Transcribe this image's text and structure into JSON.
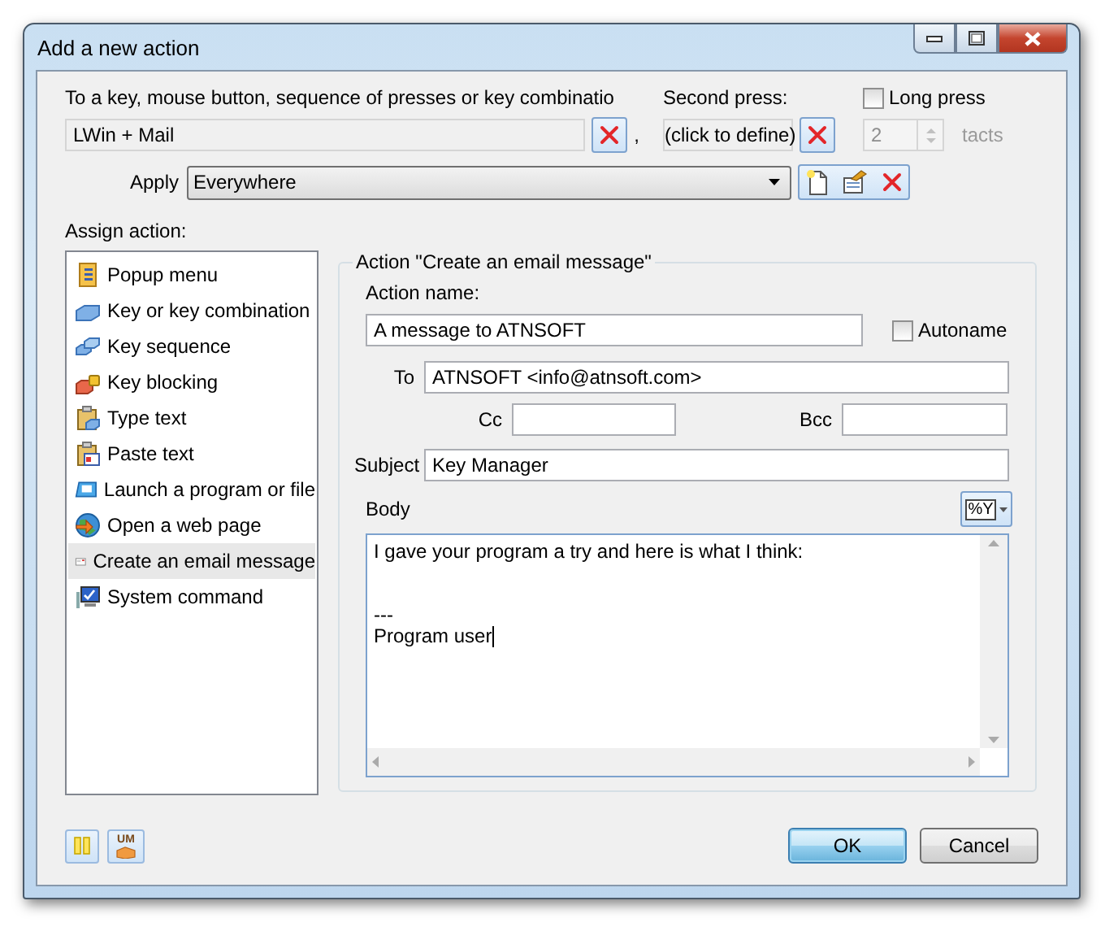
{
  "window": {
    "title": "Add a new action"
  },
  "trigger": {
    "label": "To a key, mouse button, sequence of presses or key combinatio",
    "value": "LWin + Mail",
    "separator": ","
  },
  "second_press": {
    "label": "Second press:",
    "value": "(click to define)"
  },
  "long_press": {
    "label": "Long press",
    "checked": false,
    "count": "2",
    "unit": "tacts",
    "disabled": true
  },
  "apply": {
    "label": "Apply",
    "value": "Everywhere"
  },
  "assign_action": {
    "label": "Assign action:",
    "items": [
      {
        "label": "Popup menu",
        "selected": false
      },
      {
        "label": "Key or key combination",
        "selected": false
      },
      {
        "label": "Key sequence",
        "selected": false
      },
      {
        "label": "Key blocking",
        "selected": false
      },
      {
        "label": "Type text",
        "selected": false
      },
      {
        "label": "Paste text",
        "selected": false
      },
      {
        "label": "Launch a program or file",
        "selected": false
      },
      {
        "label": "Open a web page",
        "selected": false
      },
      {
        "label": "Create an email message",
        "selected": true
      },
      {
        "label": "System command",
        "selected": false
      }
    ]
  },
  "action": {
    "title": "Action \"Create an email message\"",
    "name_label": "Action name:",
    "name": "A message to ATNSOFT",
    "autoname": {
      "label": "Autoname",
      "checked": false
    },
    "to": {
      "label": "To",
      "value": "ATNSOFT <info@atnsoft.com>"
    },
    "cc": {
      "label": "Cc"
    },
    "bcc": {
      "label": "Bcc"
    },
    "subject": {
      "label": "Subject",
      "value": "Key Manager"
    },
    "body": {
      "label": "Body",
      "macro_button": "%Y",
      "text": "I gave your program a try and here is what I think:\n\n\n---\nProgram user"
    }
  },
  "tool_badge": "UM",
  "buttons": [
    {
      "label": "OK",
      "default": true
    },
    {
      "label": "Cancel",
      "default": false
    }
  ]
}
